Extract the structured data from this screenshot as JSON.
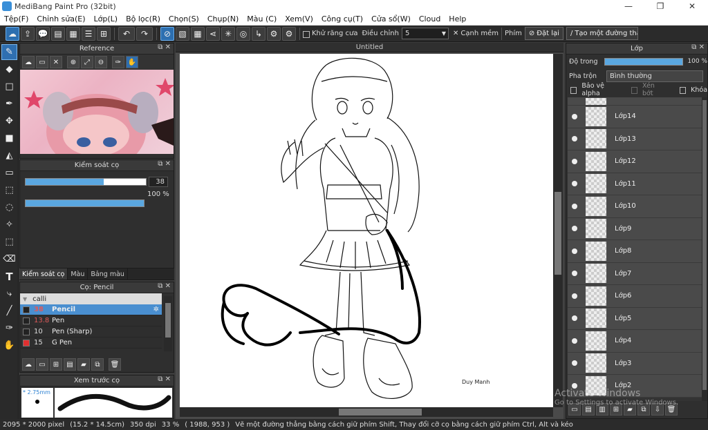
{
  "window": {
    "title": "MediBang Paint Pro (32bit)"
  },
  "menu": [
    "Tệp(F)",
    "Chỉnh sửa(E)",
    "Lớp(L)",
    "Bộ lọc(R)",
    "Chọn(S)",
    "Chụp(N)",
    "Màu (C)",
    "Xem(V)",
    "Công cụ(T)",
    "Cửa sổ(W)",
    "Cloud",
    "Help"
  ],
  "toolbar": {
    "antialias_label": "Khử răng cưa",
    "correction_label": "Điều chỉnh",
    "correction_value": "5",
    "soft_edge_label": "Cạnh mềm",
    "key_label": "Phím",
    "reset_label": "Đặt lại",
    "straight_line_label": "Tạo một đường thẳng"
  },
  "reference_panel": {
    "title": "Reference"
  },
  "brush_control": {
    "title": "Kiểm soát cọ",
    "size_value": "38",
    "opacity_value": "100 %",
    "size_fraction": 0.65,
    "opacity_fraction": 1.0
  },
  "left_tabs": [
    "Kiểm soát cọ",
    "Màu",
    "Bảng màu"
  ],
  "brush_panel": {
    "title": "Cọ: Pencil",
    "group": "calli",
    "brushes": [
      {
        "size": "38",
        "name": "Pencil",
        "color": "#222222",
        "selected": true
      },
      {
        "size": "13.8",
        "name": "Pen",
        "color": "#222222",
        "selected": false
      },
      {
        "size": "10",
        "name": "Pen (Sharp)",
        "color": "#222222",
        "selected": false
      },
      {
        "size": "15",
        "name": "G Pen",
        "color": "#e03030",
        "selected": false
      }
    ]
  },
  "preview_panel": {
    "title": "Xem trước cọ",
    "size_label": "* 2.75mm"
  },
  "canvas": {
    "tab": "Untitled"
  },
  "layers_panel": {
    "title": "Lớp",
    "opacity_label": "Độ trong",
    "opacity_value": "100 %",
    "opacity_fraction": 1.0,
    "blend_label": "Pha trộn",
    "blend_value": "Bình thường",
    "protect_alpha_label": "Bảo vệ alpha",
    "clipping_label": "Xén bớt",
    "lock_label": "Khóa",
    "layers": [
      "Lớp14",
      "Lớp13",
      "Lớp12",
      "Lớp11",
      "Lớp10",
      "Lớp9",
      "Lớp8",
      "Lớp7",
      "Lớp6",
      "Lớp5",
      "Lớp4",
      "Lớp3",
      "Lớp2"
    ]
  },
  "watermark": {
    "line1": "Activate Windows",
    "line2": "Go to Settings to activate Windows."
  },
  "status": {
    "pixel_size": "2095 * 2000 pixel",
    "cm_size": "(15.2 * 14.5cm)",
    "dpi": "350 dpi",
    "zoom": "33 %",
    "coords": "( 1988, 953 )",
    "hint": "Vẽ một đường thẳng bằng cách giữ phím Shift, Thay đổi cỡ cọ bằng cách giữ phím Ctrl, Alt và kéo"
  },
  "signature_text": "Duy Manh"
}
